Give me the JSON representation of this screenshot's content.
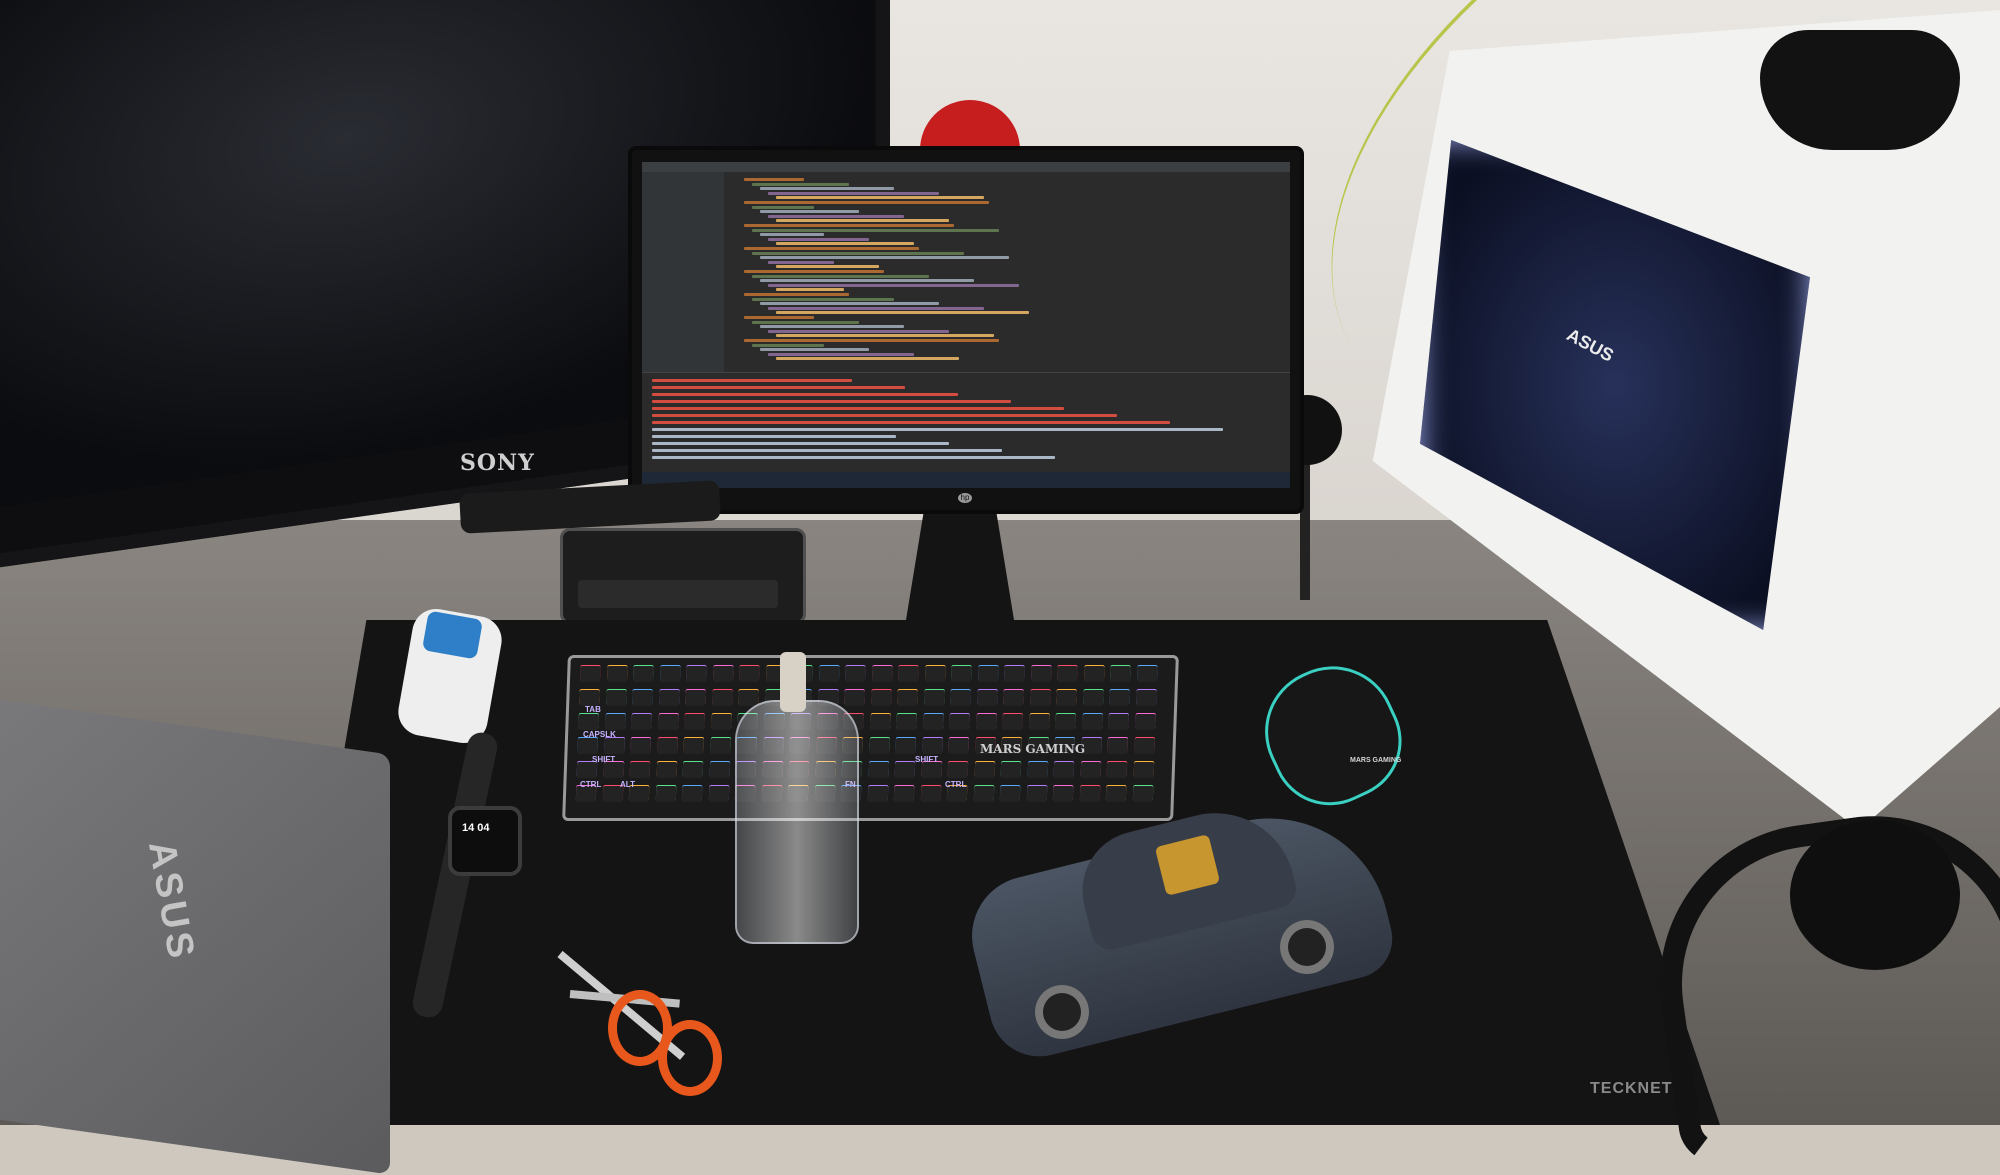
{
  "scene": {
    "tv": {
      "brand": "SONY"
    },
    "monitor": {
      "logo": "hp",
      "screen": {
        "app": "IDE",
        "theme_color": "#2b2b2b",
        "error_color": "#d24d3f"
      }
    },
    "pc_tower": {
      "gpu_brand": "ASUS",
      "case_color": "#f2f2f0",
      "glow_color": "#6677ff"
    },
    "keyboard": {
      "brand": "MARS GAMING",
      "key_labels": [
        "TAB",
        "CAPSLK",
        "SHIFT",
        "CTRL",
        "ALT",
        "FN",
        "SHIFT",
        "CTRL"
      ]
    },
    "mouse": {
      "brand": "MARS GAMING",
      "accent_color": "#3ad0c2"
    },
    "laptop": {
      "brand": "ASUS"
    },
    "watch": {
      "time": "14 04"
    },
    "desk_mat": {
      "brand": "TECKNET"
    },
    "scissors": {
      "handle_color": "#e8571b"
    }
  }
}
